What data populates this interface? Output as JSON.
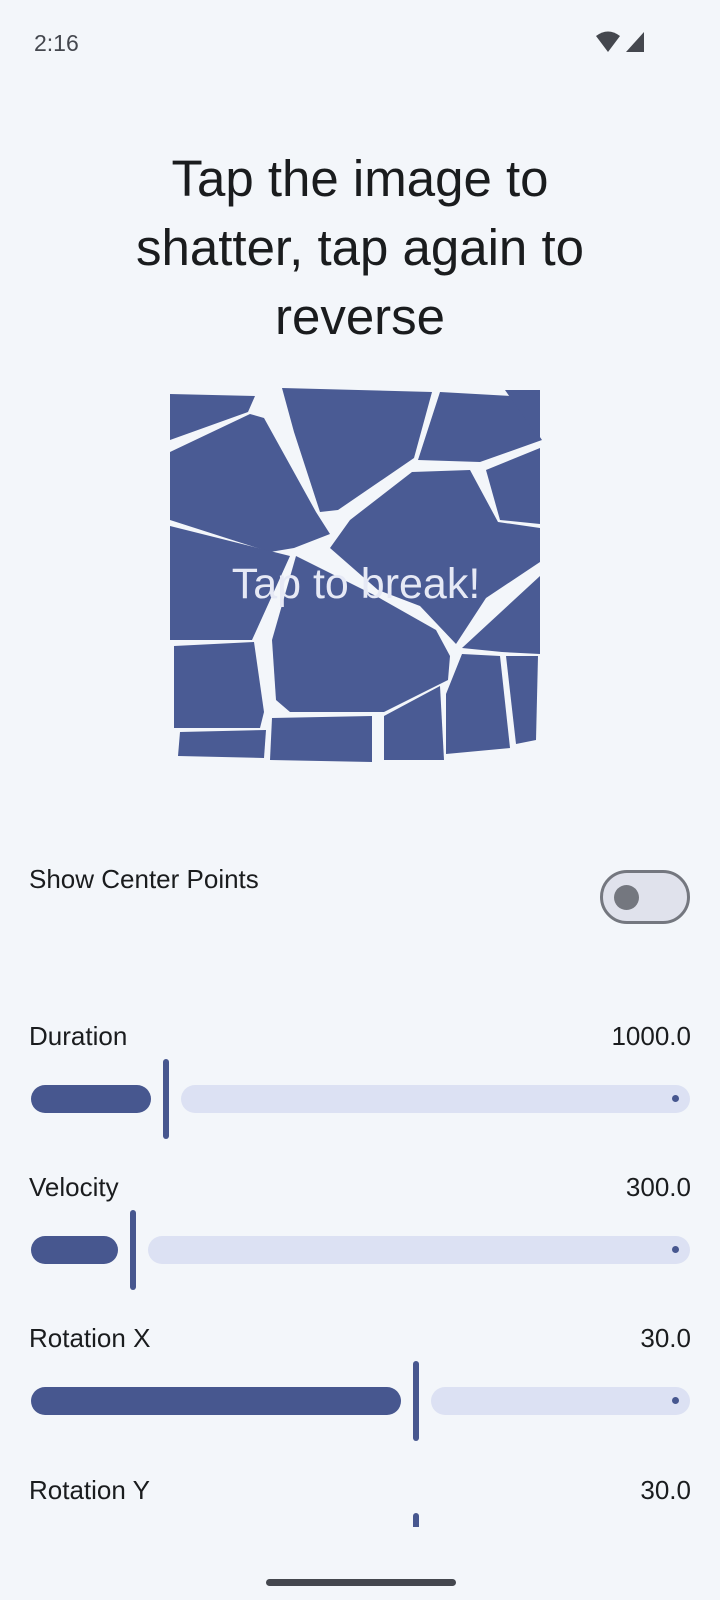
{
  "status_bar": {
    "time": "2:16",
    "icons": [
      "wifi-icon",
      "cell-signal-icon"
    ]
  },
  "headline": "Tap the image to shatter, tap again to reverse",
  "shatter_image": {
    "label": "Tap to break!",
    "fill_color": "#4a5b94",
    "label_color": "#e6e9f5"
  },
  "toggle": {
    "label": "Show Center Points",
    "checked": false
  },
  "sliders": [
    {
      "label": "Duration",
      "value": "1000.0",
      "fraction": 0.2
    },
    {
      "label": "Velocity",
      "value": "300.0",
      "fraction": 0.15
    },
    {
      "label": "Rotation X",
      "value": "30.0",
      "fraction": 0.58
    },
    {
      "label": "Rotation Y",
      "value": "30.0",
      "fraction": 0.58
    }
  ],
  "colors": {
    "background": "#f3f6fa",
    "accent": "#47578f",
    "track_inactive": "#dce1f3",
    "switch_outline": "#74777f"
  }
}
